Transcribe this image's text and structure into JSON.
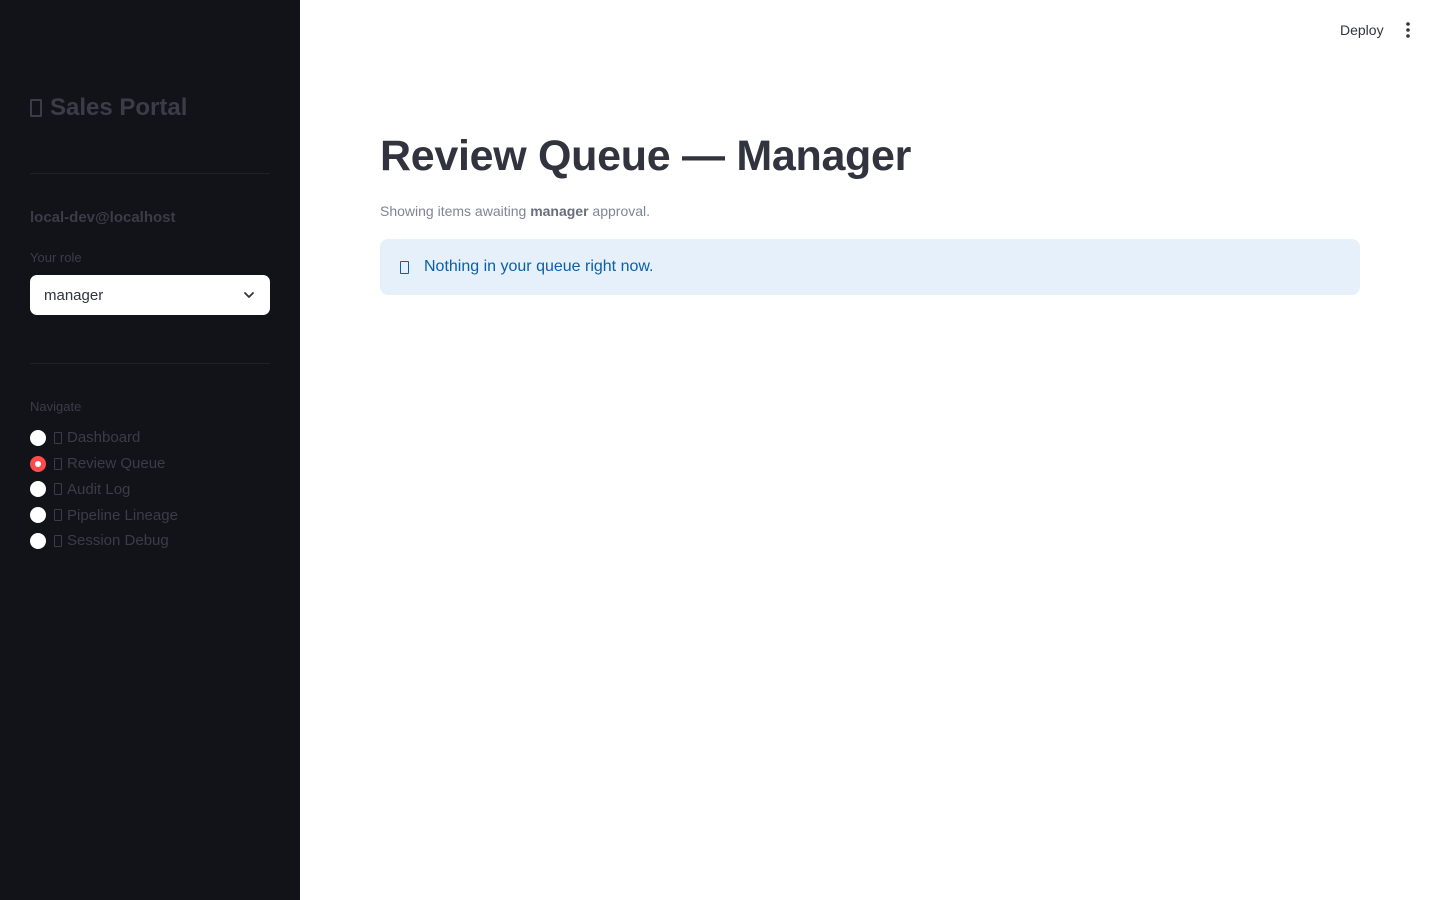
{
  "sidebar": {
    "brand": "Sales Portal",
    "user_email": "local-dev@localhost",
    "role_label": "Your role",
    "role_value": "manager",
    "nav_label": "Navigate",
    "nav_items": [
      {
        "label": "Dashboard",
        "selected": false
      },
      {
        "label": "Review Queue",
        "selected": true
      },
      {
        "label": "Audit Log",
        "selected": false
      },
      {
        "label": "Pipeline Lineage",
        "selected": false
      },
      {
        "label": "Session Debug",
        "selected": false
      }
    ]
  },
  "header": {
    "deploy_label": "Deploy"
  },
  "main": {
    "title": "Review Queue — Manager",
    "subtitle_prefix": "Showing items awaiting ",
    "subtitle_role": "manager",
    "subtitle_suffix": " approval.",
    "info_message": "Nothing in your queue right now."
  },
  "colors": {
    "sidebar_bg": "#121318",
    "accent_radio": "#ff4b4b",
    "info_bg": "#e6f0fb",
    "info_text": "#0a5fa8"
  }
}
